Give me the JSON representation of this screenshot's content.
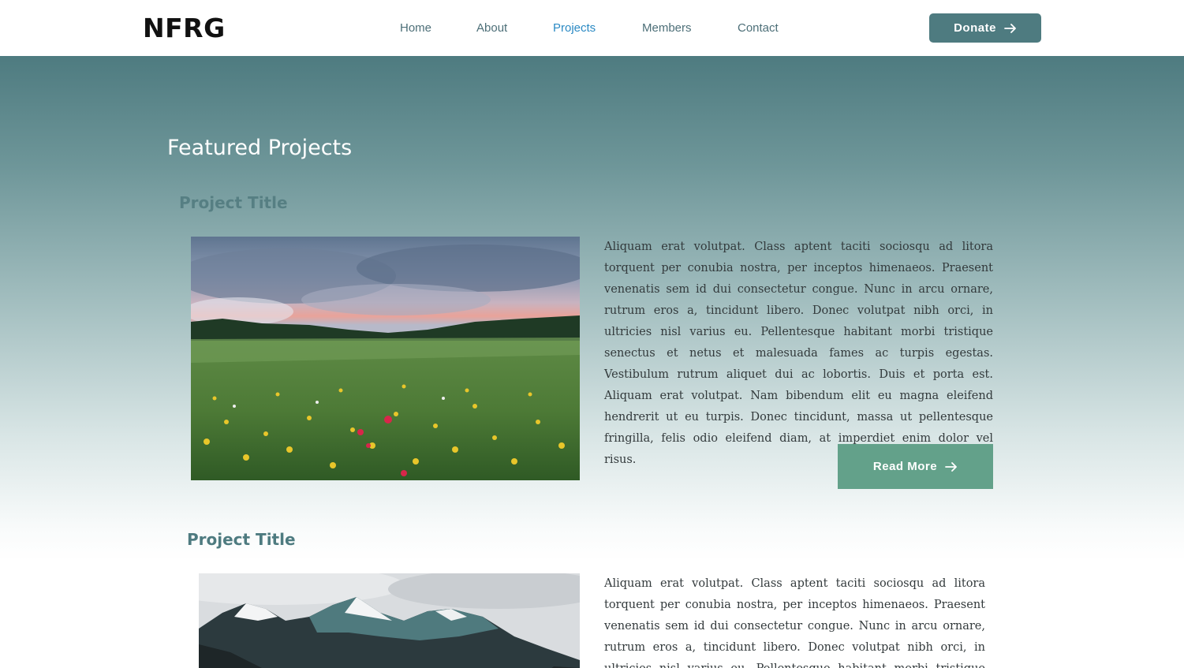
{
  "nav": {
    "logo": "NFRG",
    "links": [
      {
        "label": "Home"
      },
      {
        "label": "About"
      },
      {
        "label": "Projects"
      },
      {
        "label": "Members"
      },
      {
        "label": "Contact"
      }
    ],
    "donate_label": "Donate"
  },
  "main": {
    "section_title": "Featured Projects",
    "projects": [
      {
        "title": "Project Title",
        "image_icon": "wildflower-meadow-photo",
        "description": " Aliquam erat volutpat. Class aptent taciti sociosqu ad litora torquent per conubia nostra, per inceptos himenaeos. Praesent venenatis sem id dui consectetur congue. Nunc in arcu ornare, rutrum eros a, tincidunt libero. Donec volutpat nibh orci, in ultricies nisl varius eu. Pellentesque habitant morbi tristique senectus et netus et malesuada fames ac turpis egestas. Vestibulum rutrum aliquet dui ac lobortis. Duis et porta est. Aliquam erat volutpat. Nam bibendum elit eu magna eleifend hendrerit ut eu turpis. Donec tincidunt, massa ut pellentesque fringilla, felis odio eleifend diam, at imperdiet enim dolor vel risus.",
        "read_more_label": "Read More"
      },
      {
        "title": "Project Title",
        "image_icon": "snowy-mountains-photo",
        "description": " Aliquam erat volutpat. Class aptent taciti sociosqu ad litora torquent per conubia nostra, per inceptos himenaeos. Praesent venenatis sem id dui consectetur congue. Nunc in arcu ornare, rutrum eros a, tincidunt libero. Donec volutpat nibh orci, in ultricies nisl varius eu. Pellentesque habitant morbi tristique senectus et netus et malesuada fames ac turpis egestas."
      }
    ]
  },
  "colors": {
    "brand": "#4e7b80",
    "nav_active": "#2b8ac4",
    "read_more": "#63a18a"
  }
}
